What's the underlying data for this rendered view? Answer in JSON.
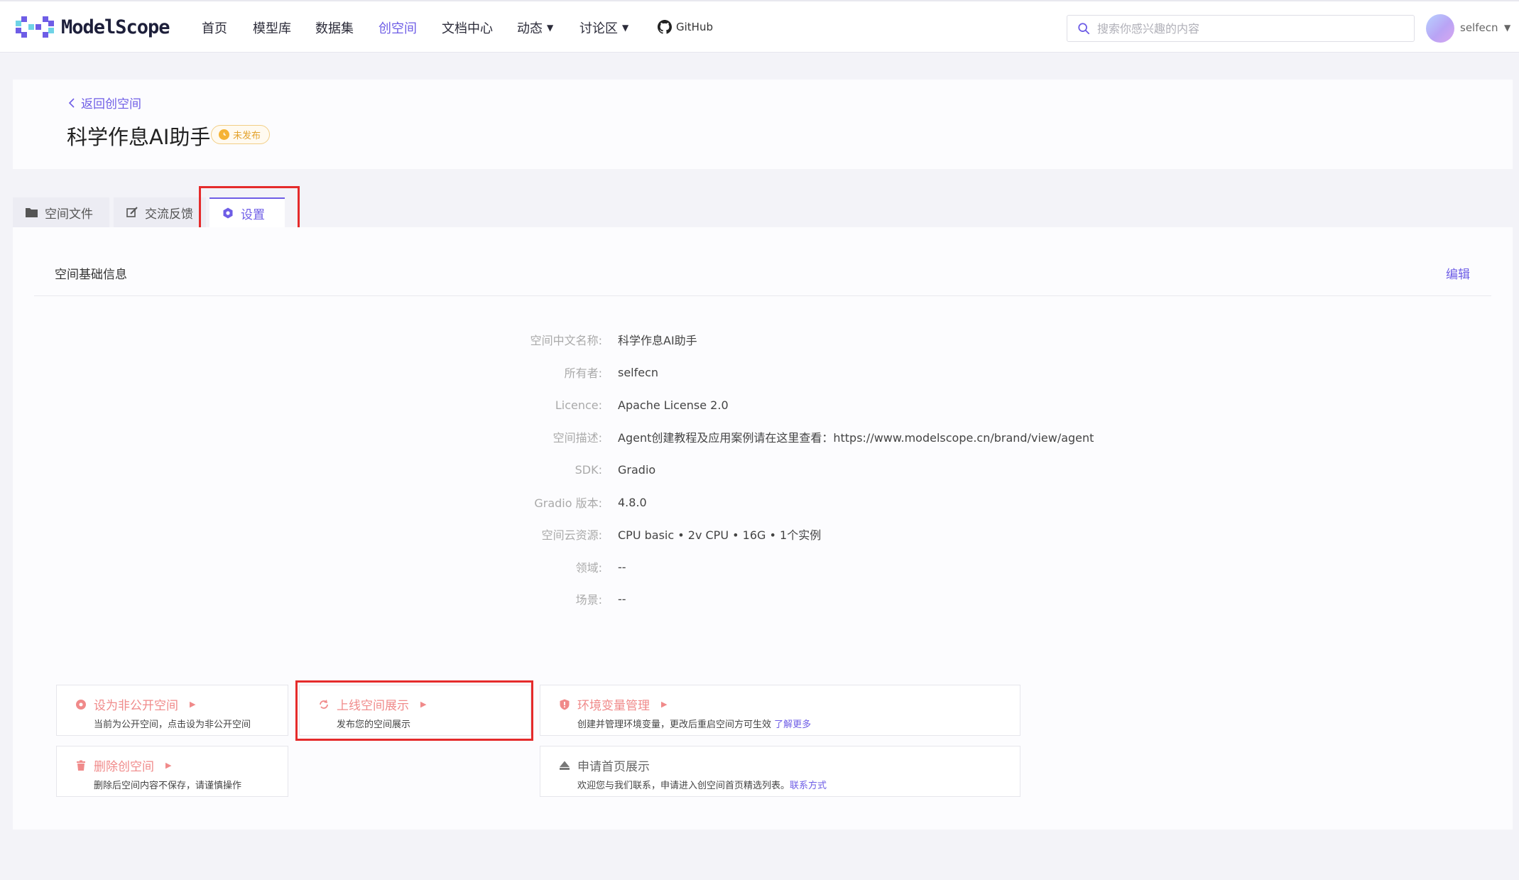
{
  "brand": {
    "name": "ModelScope"
  },
  "nav": {
    "items": [
      {
        "label": "首页",
        "active": false
      },
      {
        "label": "模型库",
        "active": false
      },
      {
        "label": "数据集",
        "active": false
      },
      {
        "label": "创空间",
        "active": true
      },
      {
        "label": "文档中心",
        "active": false
      },
      {
        "label": "动态",
        "active": false,
        "dropdown": true
      },
      {
        "label": "讨论区",
        "active": false,
        "dropdown": true
      }
    ],
    "github_label": "GitHub"
  },
  "search": {
    "placeholder": "搜索你感兴趣的内容",
    "value": ""
  },
  "user": {
    "name": "selfecn"
  },
  "header": {
    "back_label": "返回创空间",
    "title": "科学作息AI助手",
    "status_badge": "未发布"
  },
  "tabs": [
    {
      "label": "空间文件",
      "icon": "folder-icon",
      "active": false
    },
    {
      "label": "交流反馈",
      "icon": "edit-icon",
      "active": false
    },
    {
      "label": "设置",
      "icon": "gear-icon",
      "active": true
    }
  ],
  "section": {
    "title": "空间基础信息",
    "edit_label": "编辑"
  },
  "info": [
    {
      "label": "空间中文名称:",
      "value": "科学作息AI助手"
    },
    {
      "label": "所有者:",
      "value": "selfecn"
    },
    {
      "label": "Licence:",
      "value": "Apache License 2.0"
    },
    {
      "label": "空间描述:",
      "value": "Agent创建教程及应用案例请在这里查看：https://www.modelscope.cn/brand/view/agent"
    },
    {
      "label": "SDK:",
      "value": "Gradio"
    },
    {
      "label": "Gradio 版本:",
      "value": "4.8.0"
    },
    {
      "label": "空间云资源:",
      "value": "CPU basic • 2v CPU • 16G • 1个实例"
    },
    {
      "label": "领域:",
      "value": "--"
    },
    {
      "label": "场景:",
      "value": "--"
    }
  ],
  "actions": {
    "make_private": {
      "title": "设为非公开空间",
      "desc": "当前为公开空间，点击设为非公开空间",
      "icon": "eye-off-icon"
    },
    "publish": {
      "title": "上线空间展示",
      "desc": "发布您的空间展示",
      "icon": "refresh-icon"
    },
    "env": {
      "title": "环境变量管理",
      "desc": "创建并管理环境变量，更改后重启空间方可生效 ",
      "link": "了解更多",
      "icon": "shield-icon"
    },
    "delete": {
      "title": "删除创空间",
      "desc": "删除后空间内容不保存，请谨慎操作",
      "icon": "trash-icon"
    },
    "homepage": {
      "title": "申请首页展示",
      "desc": "欢迎您与我们联系，申请进入创空间首页精选列表。",
      "link": "联系方式",
      "icon": "home-icon"
    }
  },
  "colors": {
    "accent": "#6e5de6",
    "danger": "#f08a8a",
    "badge": "#e3a22c",
    "highlight": "#e52b2b"
  }
}
